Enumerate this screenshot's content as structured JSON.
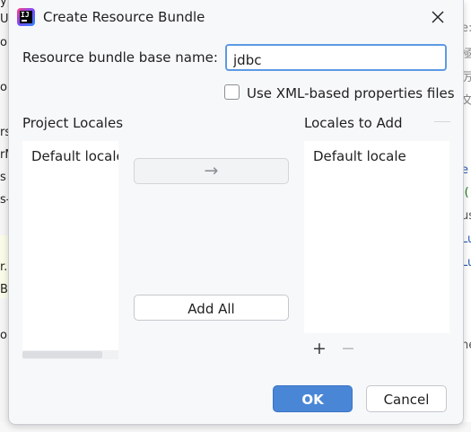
{
  "background": {
    "left_fragments": [
      "yp",
      "Us",
      "o",
      "",
      "ol",
      "",
      "",
      "rs",
      "rM",
      "s",
      "s-",
      "",
      "",
      "r.",
      "Ba",
      "",
      "or"
    ],
    "right_fragments": [
      "",
      "e:",
      "極",
      "厉",
      "文",
      "",
      "",
      "",
      "e",
      "j(",
      "us",
      "Lu",
      "Lu",
      "",
      "",
      "he"
    ]
  },
  "dialog": {
    "title": "Create Resource Bundle",
    "base_name_label": "Resource bundle base name:",
    "base_name_value": "jdbc",
    "xml_checkbox_label": "Use XML-based properties files",
    "xml_checkbox_checked": false,
    "project_locales_header": "Project Locales",
    "locales_to_add_header": "Locales to Add",
    "project_locales": [
      "Default locale"
    ],
    "locales_to_add": [
      "Default locale"
    ],
    "move_button_glyph": "→",
    "add_all_label": "Add All",
    "add_glyph": "+",
    "remove_glyph": "−",
    "ok_label": "OK",
    "cancel_label": "Cancel"
  },
  "colors": {
    "accent": "#4a86d6",
    "focus_border": "#5d9ae3"
  }
}
